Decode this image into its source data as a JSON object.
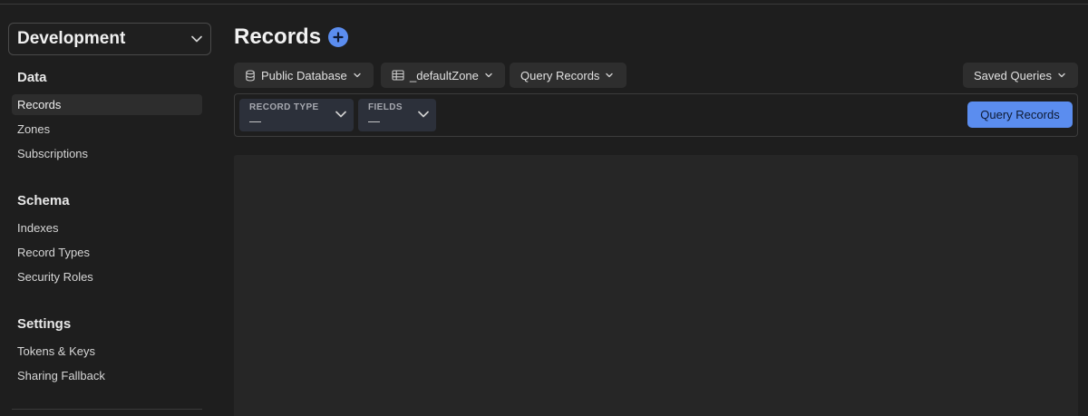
{
  "sidebar": {
    "environment": "Development",
    "sections": [
      {
        "title": "Data",
        "items": [
          {
            "label": "Records",
            "active": true
          },
          {
            "label": "Zones"
          },
          {
            "label": "Subscriptions"
          }
        ]
      },
      {
        "title": "Schema",
        "items": [
          {
            "label": "Indexes"
          },
          {
            "label": "Record Types"
          },
          {
            "label": "Security Roles"
          }
        ]
      },
      {
        "title": "Settings",
        "items": [
          {
            "label": "Tokens & Keys"
          },
          {
            "label": "Sharing Fallback"
          }
        ]
      }
    ]
  },
  "main": {
    "title": "Records",
    "add_icon": "plus-circle-icon",
    "toolbar": {
      "database": {
        "label": "Public Database",
        "icon": "database-icon"
      },
      "zone": {
        "label": "_defaultZone",
        "icon": "table-icon"
      },
      "mode": {
        "label": "Query Records"
      },
      "saved_queries": {
        "label": "Saved Queries"
      }
    },
    "filters": {
      "record_type": {
        "label": "RECORD TYPE",
        "value": "—"
      },
      "fields": {
        "label": "FIELDS",
        "value": "—"
      },
      "submit_label": "Query Records"
    }
  },
  "colors": {
    "accent": "#5b8def",
    "background": "#1e1e1e",
    "panel": "#262626"
  }
}
